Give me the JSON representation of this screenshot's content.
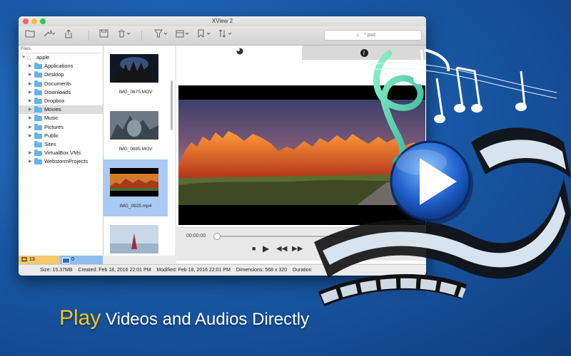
{
  "window": {
    "title": "XView 2"
  },
  "toolbar": {
    "search_placeholder": "*.psd"
  },
  "sidebar": {
    "header": "Files",
    "root": "apple",
    "items": [
      {
        "label": "Applications",
        "expandable": true,
        "selected": false
      },
      {
        "label": "Desktop",
        "expandable": true,
        "selected": false
      },
      {
        "label": "Documents",
        "expandable": true,
        "selected": false
      },
      {
        "label": "Downloads",
        "expandable": true,
        "selected": false
      },
      {
        "label": "Dropbox",
        "expandable": true,
        "selected": false
      },
      {
        "label": "Movies",
        "expandable": true,
        "selected": true
      },
      {
        "label": "Music",
        "expandable": true,
        "selected": false
      },
      {
        "label": "Pictures",
        "expandable": true,
        "selected": false
      },
      {
        "label": "Public",
        "expandable": true,
        "selected": false
      },
      {
        "label": "Sites",
        "expandable": false,
        "selected": false
      },
      {
        "label": "VirtualBox VMs",
        "expandable": true,
        "selected": false
      },
      {
        "label": "WebstormProjects",
        "expandable": true,
        "selected": false
      }
    ],
    "counter_media": "13",
    "counter_images": "0"
  },
  "thumbnails": [
    {
      "name": "IMG_0675.MOV",
      "selected": false
    },
    {
      "name": "IMG_0685.MOV",
      "selected": false
    },
    {
      "name": "IMG_0925.mp4",
      "selected": true
    },
    {
      "name": "",
      "selected": false
    }
  ],
  "player": {
    "current_time": "00:00:00",
    "progress": 0
  },
  "status": {
    "size": "Size: 15.37MB",
    "created": "Created: Feb 18, 2016 22:01 PM",
    "modified": "Modified: Feb 18, 2016 22:01 PM",
    "dimensions": "Dimensions: 568 x 320",
    "duration": "Duration"
  },
  "tagline": {
    "play": "Play",
    "rest": "Videos and Audios Directly"
  },
  "colors": {
    "selection": "#a9cbf3",
    "accent_yellow": "#f5c518",
    "folder": "#63b4ee"
  }
}
